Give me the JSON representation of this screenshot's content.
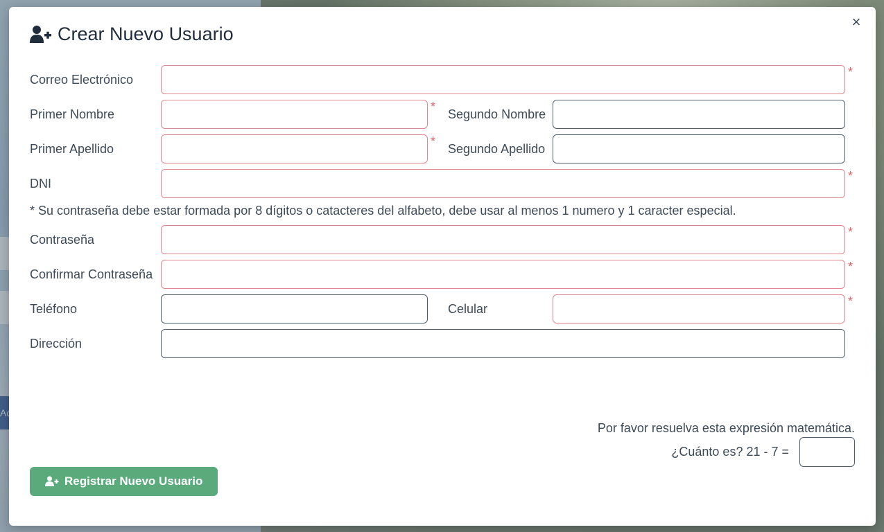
{
  "modal": {
    "title": "Crear Nuevo Usuario",
    "title_icon": "user-plus-icon",
    "close_label": "×"
  },
  "form": {
    "email_label": "Correo Electrónico",
    "first_name_label": "Primer Nombre",
    "second_name_label": "Segundo Nombre",
    "first_surname_label": "Primer Apellido",
    "second_surname_label": "Segundo Apellido",
    "dni_label": "DNI",
    "password_note": "* Su contraseña debe estar formada por 8 dígitos o catacteres del alfabeto, debe usar al menos 1 numero y 1 caracter especial.",
    "password_label": "Contraseña",
    "confirm_password_label": "Confirmar Contraseña",
    "phone_label": "Teléfono",
    "mobile_label": "Celular",
    "address_label": "Dirección",
    "required_mark": "*"
  },
  "captcha": {
    "instruction": "Por favor resuelva esta expresión matemática.",
    "question": "¿Cuánto es? 21 - 7 ="
  },
  "submit": {
    "label": "Registrar Nuevo Usuario",
    "icon": "user-plus-icon",
    "color": "#5aaa7b"
  },
  "colors": {
    "required_border": "#e4848c",
    "required_star": "#e0626b"
  },
  "background": {
    "button_fragment": "Ac"
  }
}
